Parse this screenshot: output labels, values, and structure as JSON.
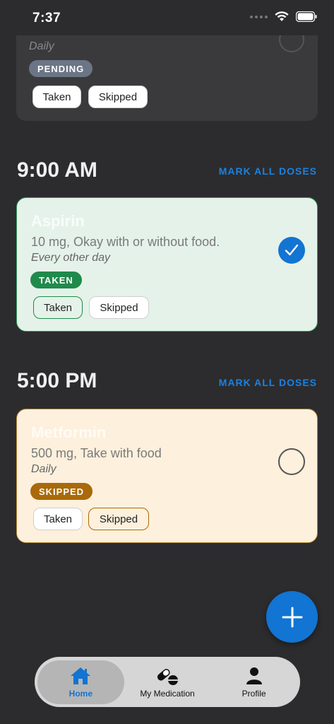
{
  "status": {
    "time": "7:37"
  },
  "prev_card": {
    "name": "",
    "frequency": "Daily",
    "status_badge": "PENDING",
    "taken_label": "Taken",
    "skipped_label": "Skipped"
  },
  "sections": [
    {
      "time": "9:00 AM",
      "mark_all": "MARK ALL DOSES",
      "med": {
        "name": "Aspirin",
        "detail": "10 mg, Okay with or without food.",
        "frequency": "Every other day",
        "status_badge": "TAKEN",
        "taken_label": "Taken",
        "skipped_label": "Skipped"
      }
    },
    {
      "time": "5:00 PM",
      "mark_all": "MARK ALL DOSES",
      "med": {
        "name": "Metformin",
        "detail": "500 mg, Take with food",
        "frequency": "Daily",
        "status_badge": "SKIPPED",
        "taken_label": "Taken",
        "skipped_label": "Skipped"
      }
    }
  ],
  "tabbar": {
    "home": "Home",
    "my_medication": "My Medication",
    "profile": "Profile"
  },
  "colors": {
    "accent": "#1274d3",
    "taken": "#1f8a4c",
    "skipped": "#a86a0a",
    "pending": "#6b7585"
  },
  "icons": [
    "wifi-icon",
    "battery-icon",
    "home-icon",
    "pills-icon",
    "person-icon",
    "plus-icon",
    "checkmark-icon"
  ]
}
